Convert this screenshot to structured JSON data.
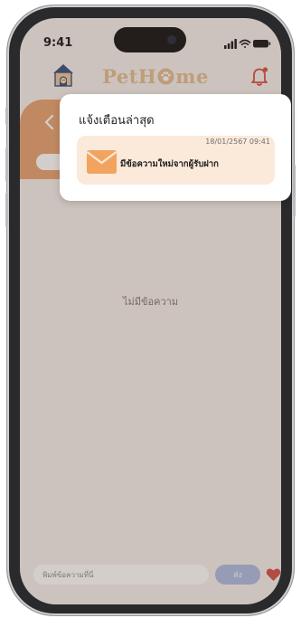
{
  "status_bar": {
    "time": "9:41",
    "icons": [
      "cellular-signal-icon",
      "wifi-icon",
      "battery-icon"
    ]
  },
  "header": {
    "logo_prefix": "PetH",
    "logo_suffix": "me",
    "logo_icon": "paw-icon",
    "home_icon": "pet-house-icon",
    "bell_icon": "bell-icon"
  },
  "chat": {
    "back_icon": "chevron-left-icon",
    "empty_text": "ไม่มีข้อความ",
    "input_placeholder": "พิมพ์ข้อความที่นี่",
    "send_label": "ส่ง",
    "like_icon": "heart-icon"
  },
  "notifications": {
    "title": "แจ้งเตือนล่าสุด",
    "items": [
      {
        "date": "18/01/2567 09:41",
        "message": "มีข้อความใหม่จากผู้รับฝาก",
        "icon": "envelope-icon"
      }
    ]
  },
  "colors": {
    "brand": "#e1bb8f",
    "accent_brown": "#e4a06c",
    "notification_bg": "#fbe9da",
    "envelope": "#f2a45f",
    "send_button": "#a9b9e2",
    "heart": "#d14b45",
    "bell": "#d9473b"
  }
}
